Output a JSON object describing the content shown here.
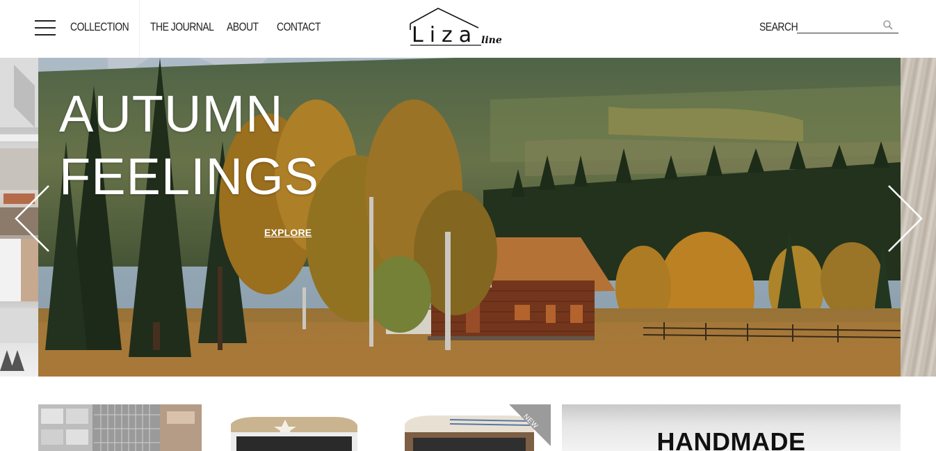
{
  "header": {
    "nav": {
      "collection": "COLLECTION",
      "journal": "THE JOURNAL",
      "about": "ABOUT",
      "contact": "CONTACT"
    },
    "logo": {
      "main": "Liza",
      "sub": "line"
    },
    "search": {
      "label": "SEARCH",
      "value": "",
      "placeholder": ""
    }
  },
  "hero": {
    "title_line1": "AUTUMN",
    "title_line2": "FEELINGS",
    "cta": "EXPLORE"
  },
  "products": {
    "badge": "NEW",
    "promo_title": "HANDMADE"
  },
  "icons": {
    "menu": "hamburger-menu-icon",
    "search": "magnifier-icon",
    "prev": "chevron-left-icon",
    "next": "chevron-right-icon"
  }
}
